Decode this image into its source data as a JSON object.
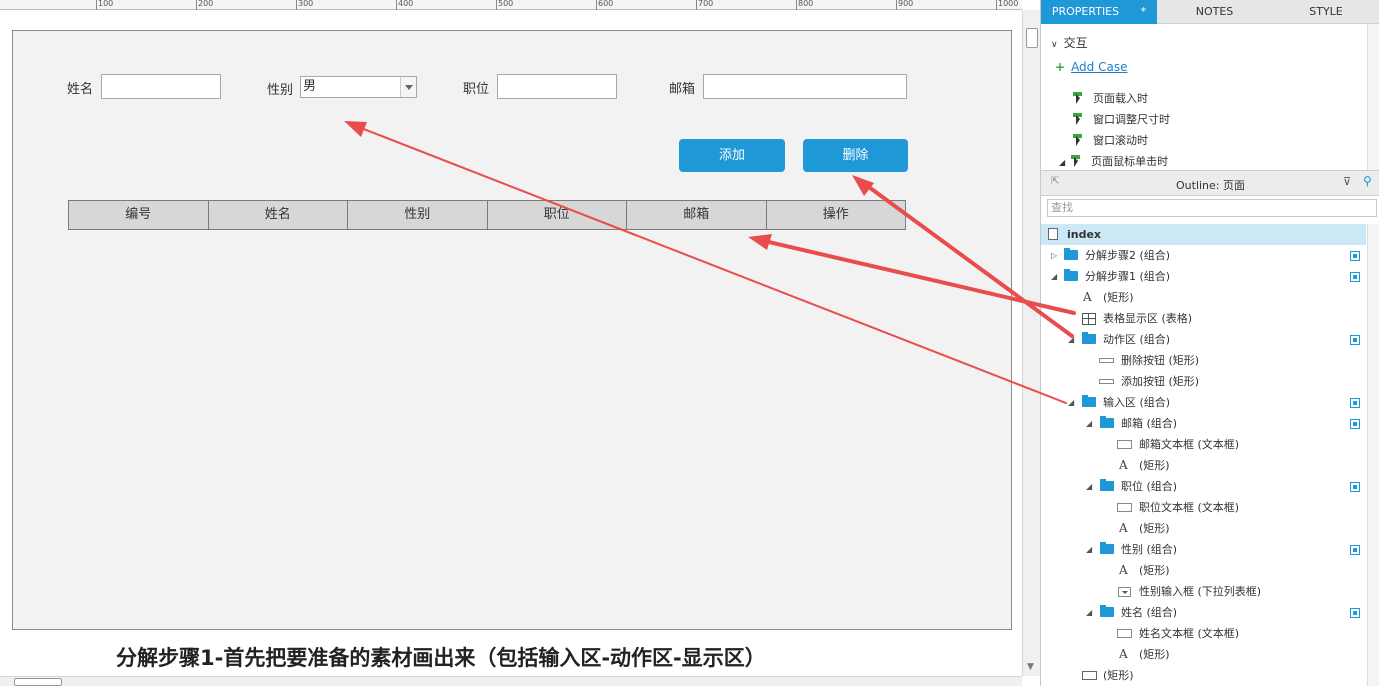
{
  "ruler": {
    "labels": [
      "100",
      "200",
      "300",
      "400",
      "500",
      "600",
      "700",
      "800",
      "900",
      "1000"
    ]
  },
  "form": {
    "name_label": "姓名",
    "gender_label": "性别",
    "gender_value": "男",
    "position_label": "职位",
    "email_label": "邮箱",
    "add_button": "添加",
    "delete_button": "删除"
  },
  "table": {
    "headers": [
      "编号",
      "姓名",
      "性别",
      "职位",
      "邮箱",
      "操作"
    ]
  },
  "caption": "分解步骤1-首先把要准备的素材画出来（包括输入区-动作区-显示区）",
  "panel": {
    "tabs": {
      "properties": "PROPERTIES",
      "properties_mark": "*",
      "notes": "NOTES",
      "style": "STYLE"
    },
    "interaction_header": "交互",
    "add_case": "Add Case",
    "events": [
      "页面载入时",
      "窗口调整尺寸时",
      "窗口滚动时",
      "页面鼠标单击时"
    ],
    "outline_title": "Outline: 页面",
    "search_placeholder": "查找",
    "tree": [
      {
        "label": "index"
      },
      {
        "label": "分解步骤2 (组合)"
      },
      {
        "label": "分解步骤1 (组合)"
      },
      {
        "label": "(矩形)"
      },
      {
        "label": "表格显示区 (表格)"
      },
      {
        "label": "动作区 (组合)"
      },
      {
        "label": "删除按钮 (矩形)"
      },
      {
        "label": "添加按钮 (矩形)"
      },
      {
        "label": "输入区 (组合)"
      },
      {
        "label": "邮箱 (组合)"
      },
      {
        "label": "邮箱文本框 (文本框)"
      },
      {
        "label": "(矩形)"
      },
      {
        "label": "职位 (组合)"
      },
      {
        "label": "职位文本框 (文本框)"
      },
      {
        "label": "(矩形)"
      },
      {
        "label": "性别 (组合)"
      },
      {
        "label": "(矩形)"
      },
      {
        "label": "性别输入框 (下拉列表框)"
      },
      {
        "label": "姓名 (组合)"
      },
      {
        "label": "姓名文本框 (文本框)"
      },
      {
        "label": "(矩形)"
      },
      {
        "label": "(矩形)"
      }
    ]
  },
  "colors": {
    "accent": "#1e98d7",
    "arrow": "#e84c4c",
    "selected": "#cce8f6"
  }
}
